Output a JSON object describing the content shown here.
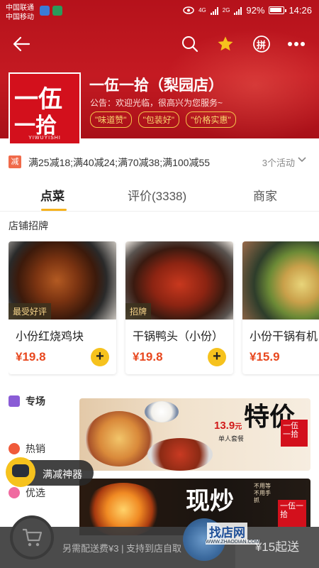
{
  "status_bar": {
    "carrier1": "中国联通",
    "carrier2": "中国移动",
    "net1": "4G",
    "net2": "2G",
    "battery": "92%",
    "time": "14:26"
  },
  "shop": {
    "name": "一伍一拾（梨园店）",
    "notice": "公告：欢迎光临，很高兴为您服务~",
    "logo_line1": "一伍",
    "logo_line2": "一拾",
    "logo_tag": "YIWUYISHI",
    "tags": [
      "\"味道赞\"",
      "\"包装好\"",
      "\"价格实惠\""
    ]
  },
  "nav": {
    "pin_label": "拼",
    "icons": [
      "back-arrow-icon",
      "search-icon",
      "star-icon",
      "pin-icon",
      "more-icon"
    ]
  },
  "promo": {
    "icon": "减",
    "text": "满25减18;满40减24;满70减38;满100减55",
    "count": "3个活动"
  },
  "tabs": [
    "点菜",
    "评价(3338)",
    "商家"
  ],
  "section_title": "店铺招牌",
  "dishes": [
    {
      "name": "小份红烧鸡块",
      "price": "¥19.8",
      "badge": "最受好评"
    },
    {
      "name": "干锅鸭头（小份）",
      "price": "¥19.8",
      "badge": "招牌"
    },
    {
      "name": "小份干锅有机",
      "price": "¥15.9",
      "badge": ""
    }
  ],
  "categories": [
    {
      "label": "专场",
      "color": "#8a5cd6"
    },
    {
      "label": "热销",
      "color": "#f05a3a"
    },
    {
      "label": "优选",
      "color": "#f06aa0"
    }
  ],
  "banner1": {
    "price": "13.9",
    "unit": "元",
    "sub": "单人套餐",
    "big": "特价",
    "logo": "一伍一拾"
  },
  "banner2": {
    "big": "现炒",
    "side": "不用等 不用手抓",
    "logo": "一伍一拾"
  },
  "float_pill": {
    "label": "满减神器"
  },
  "cart": {
    "info": "另需配送费¥3 | 支持到店自取",
    "min": "¥15起送"
  },
  "watermark": {
    "text": "找店网",
    "sub": "WWW.ZHAODIAN.COM"
  },
  "colors": {
    "brand_red": "#c41a22",
    "accent_yellow": "#f6c21d",
    "price_red": "#e8481f"
  }
}
